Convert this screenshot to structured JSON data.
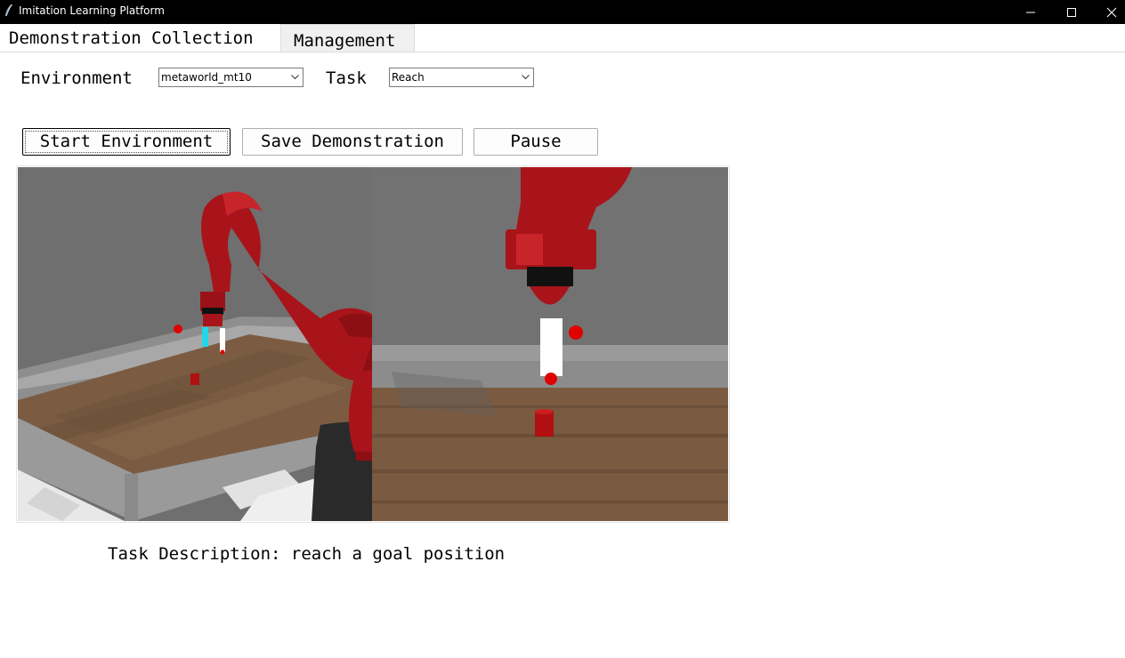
{
  "window": {
    "title": "Imitation Learning Platform",
    "controls": [
      "minimize",
      "maximize",
      "close"
    ]
  },
  "tabs": [
    {
      "label": "Demonstration Collection",
      "active": true
    },
    {
      "label": "Management",
      "active": false
    }
  ],
  "form": {
    "environment_label": "Environment",
    "environment_value": "metaworld_mt10",
    "task_label": "Task",
    "task_value": "Reach"
  },
  "buttons": {
    "start": "Start Environment",
    "save": "Save Demonstration",
    "pause": "Pause"
  },
  "viewport": {
    "views": [
      "perspective-camera-view",
      "front-camera-view"
    ],
    "robot_color": "#a8141a",
    "goal_color": "#e00000",
    "table_color": "#7a5a40",
    "wall_color": "#6e6e6e"
  },
  "task": {
    "description": "Task Description: reach a goal position"
  },
  "colors": {
    "titlebar": "#000000",
    "tab_inactive": "#f0f0f0",
    "button_border": "#adadad"
  }
}
